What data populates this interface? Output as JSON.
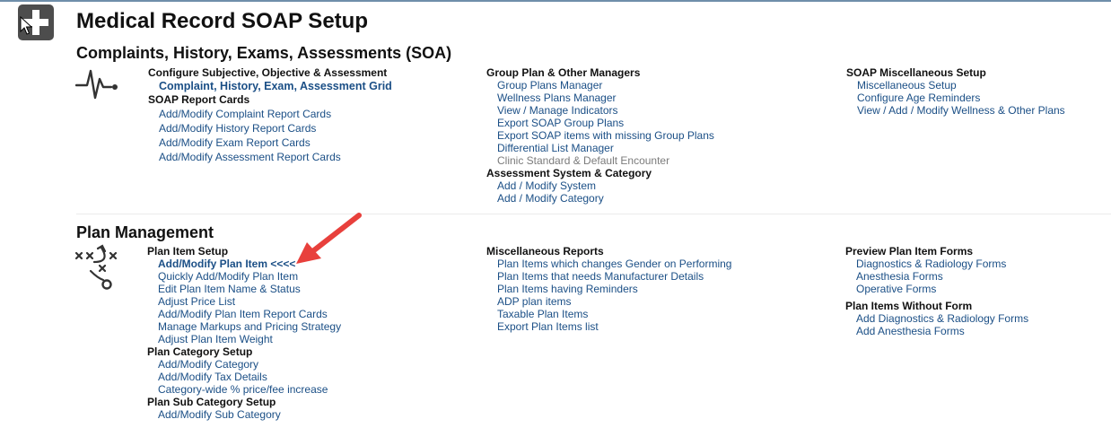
{
  "page": {
    "title": "Medical Record SOAP Setup"
  },
  "sections": [
    {
      "title": "Complaints, History, Exams, Assessments (SOA)",
      "columns": [
        {
          "groups": [
            {
              "header": "Configure Subjective, Objective & Assessment",
              "items": [
                "Complaint, History, Exam, Assessment Grid"
              ]
            },
            {
              "header": "SOAP Report Cards",
              "items": [
                "Add/Modify Complaint Report Cards",
                "Add/Modify History Report Cards",
                "Add/Modify Exam Report Cards",
                "Add/Modify Assessment Report Cards"
              ]
            }
          ]
        },
        {
          "groups": [
            {
              "header": "Group Plan & Other Managers",
              "items": [
                "Group Plans Manager",
                "Wellness Plans Manager",
                "View / Manage Indicators",
                "Export SOAP Group Plans",
                "Export SOAP items with missing Group Plans",
                "Differential List Manager",
                "Clinic Standard & Default Encounter"
              ]
            },
            {
              "header": "Assessment System & Category",
              "items": [
                "Add / Modify System",
                "Add / Modify Category"
              ]
            }
          ]
        },
        {
          "groups": [
            {
              "header": "SOAP Miscellaneous Setup",
              "items": [
                "Miscellaneous Setup",
                "Configure Age Reminders",
                "View / Add / Modify Wellness & Other Plans"
              ]
            }
          ]
        }
      ]
    },
    {
      "title": "Plan Management",
      "columns": [
        {
          "groups": [
            {
              "header": "Plan Item Setup",
              "items": [
                "Add/Modify Plan Item <<<<",
                "Quickly Add/Modify Plan Item",
                "Edit Plan Item Name & Status",
                "Adjust Price List",
                "Add/Modify Plan Item Report Cards",
                "Manage Markups and Pricing Strategy",
                "Adjust Plan Item Weight"
              ]
            },
            {
              "header": "Plan Category Setup",
              "items": [
                "Add/Modify Category",
                "Add/Modify Tax Details",
                "Category-wide % price/fee increase"
              ]
            },
            {
              "header": "Plan Sub Category Setup",
              "items": [
                "Add/Modify Sub Category"
              ]
            }
          ]
        },
        {
          "groups": [
            {
              "header": "Miscellaneous Reports",
              "items": [
                "Plan Items which changes Gender on Performing",
                "Plan Items that needs Manufacturer Details",
                "Plan Items having Reminders",
                "ADP plan items",
                "Taxable Plan Items",
                "Export Plan Items list"
              ]
            }
          ]
        },
        {
          "groups": [
            {
              "header": "Preview Plan Item Forms",
              "items": [
                "Diagnostics & Radiology Forms",
                "Anesthesia Forms",
                "Operative Forms"
              ]
            },
            {
              "header": "Plan Items Without Form",
              "items": [
                "Add Diagnostics & Radiology Forms",
                "Add Anesthesia Forms"
              ]
            }
          ]
        }
      ]
    }
  ],
  "colors": {
    "link": "#1b4f86",
    "disabled_link": "#7b7b7b",
    "annotation_arrow": "#e8403c",
    "logo_bg": "#4d4d4d"
  },
  "icons": {
    "logo": "plus-icon",
    "soa_section": "heartbeat-icon",
    "plan_section": "strategy-play-icon",
    "annotation": "red-arrow-icon"
  }
}
